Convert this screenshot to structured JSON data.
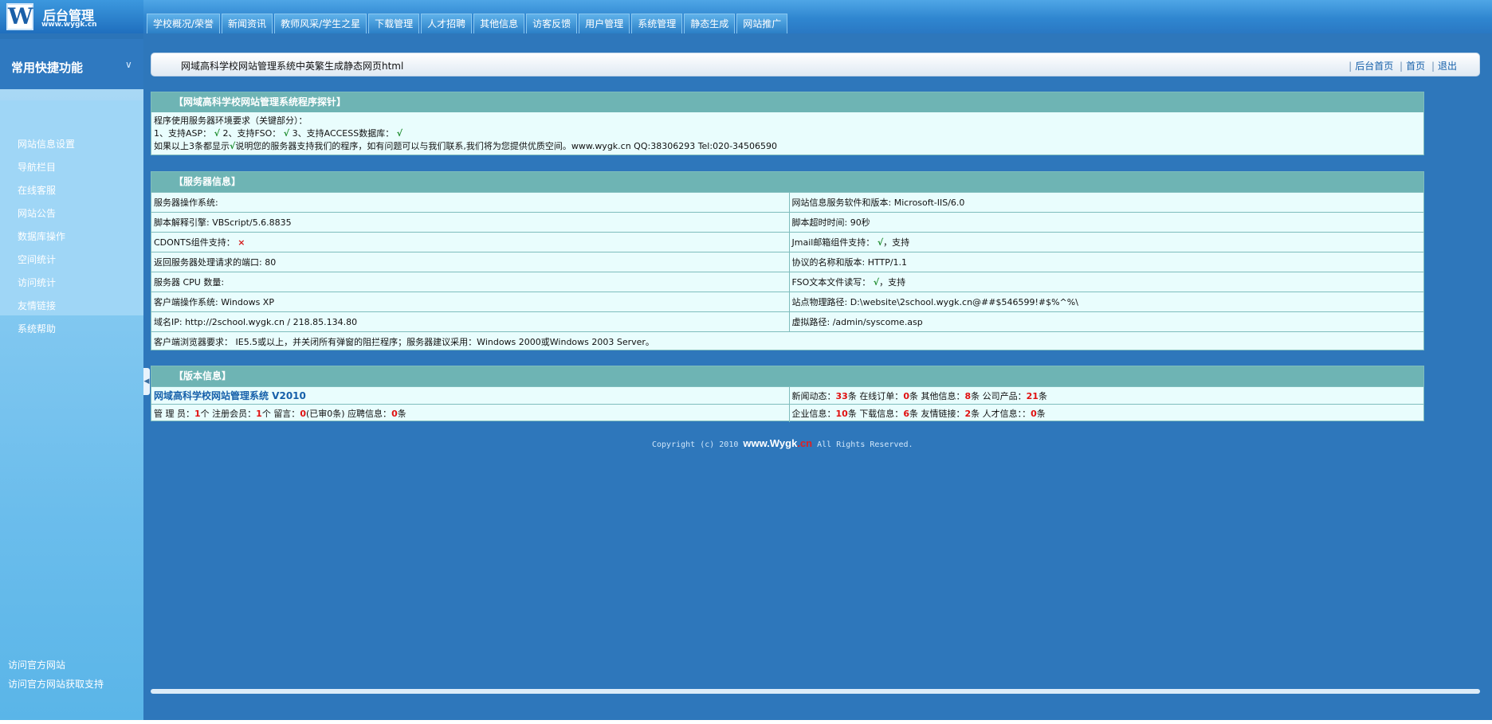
{
  "logo": {
    "letter": "W",
    "title": "后台管理",
    "url": "www.wygk.cn"
  },
  "nav": [
    "学校概况/荣誉",
    "新闻资讯",
    "教师风采/学生之星",
    "下载管理",
    "人才招聘",
    "其他信息",
    "访客反馈",
    "用户管理",
    "系统管理",
    "静态生成",
    "网站推广"
  ],
  "sidebar": {
    "title": "常用快捷功能",
    "items": [
      "网站信息设置",
      "导航栏目",
      "在线客服",
      "网站公告",
      "数据库操作",
      "空间统计",
      "访问统计",
      "友情链接",
      "系统帮助"
    ],
    "footer": [
      "访问官方网站",
      "访问官方网站获取支持"
    ]
  },
  "titlebar": {
    "text": "网域高科学校网站管理系统中英繁生成静态网页html",
    "links": [
      "后台首页",
      "首页",
      "退出"
    ]
  },
  "panel1": {
    "head": "【网域高科学校网站管理系统程序探针】",
    "line1": "程序使用服务器环境要求（关键部分）：",
    "line2_a": "1、支持ASP：",
    "line2_b": "2、支持FSO：",
    "line2_c": "3、支持ACCESS数据库：",
    "line3_a": "如果以上3条都显示",
    "line3_b": "说明您的服务器支持我们的程序，如有问题可以与我们联系,我们将为您提供优质空间。www.wygk.cn QQ:38306293 Tel:020-34506590",
    "check": "√"
  },
  "panel2": {
    "head": "【服务器信息】",
    "rows": [
      [
        "服务器操作系统:",
        "网站信息服务软件和版本: Microsoft-IIS/6.0"
      ],
      [
        "脚本解释引擎: VBScript/5.6.8835",
        "脚本超时时间: 90秒"
      ],
      [
        "CDONTS组件支持：",
        "Jmail邮箱组件支持："
      ],
      [
        "返回服务器处理请求的端口: 80",
        "协议的名称和版本: HTTP/1.1"
      ],
      [
        "服务器 CPU 数量:",
        "FSO文本文件读写："
      ],
      [
        "客户端操作系统:  Windows XP",
        "站点物理路径: D:\\website\\2school.wygk.cn@##$546599!#$%^%\\"
      ],
      [
        "域名IP: http://2school.wygk.cn  /  218.85.134.80",
        "虚拟路径: /admin/syscome.asp"
      ]
    ],
    "support_text": "，支持",
    "cross": "×",
    "check": "√",
    "last_row": "客户端浏览器要求： IE5.5或以上，并关闭所有弹窗的阻拦程序；服务器建议采用：Windows 2000或Windows 2003 Server。"
  },
  "panel3": {
    "head": "【版本信息】",
    "version": "网域高科学校网站管理系统 V2010",
    "stats_right1": [
      {
        "label": "新闻动态：",
        "value": "33",
        "unit": "条"
      },
      {
        "label": "在线订单：",
        "value": "0",
        "unit": "条"
      },
      {
        "label": "其他信息：",
        "value": "8",
        "unit": "条"
      },
      {
        "label": "公司产品：",
        "value": "21",
        "unit": "条"
      }
    ],
    "stats_left2": [
      {
        "label": "管 理 员：",
        "value": "1",
        "unit": "个"
      },
      {
        "label": "注册会员：",
        "value": "1",
        "unit": "个"
      },
      {
        "label": "留言：",
        "value": "0",
        "unit": "(已审0条)"
      },
      {
        "label": "应聘信息：",
        "value": "0",
        "unit": "条"
      }
    ],
    "stats_right2": [
      {
        "label": "企业信息：",
        "value": "10",
        "unit": "条"
      },
      {
        "label": "下载信息：",
        "value": "6",
        "unit": "条"
      },
      {
        "label": "友情链接：",
        "value": "2",
        "unit": "条"
      },
      {
        "label": "人才信息：：",
        "value": "0",
        "unit": "条"
      }
    ]
  },
  "copyright": {
    "prefix": "Copyright (c) 2010",
    "brand": "www.Wygk",
    "brand_cn": ".cn",
    "suffix": "All Rights Reserved."
  }
}
